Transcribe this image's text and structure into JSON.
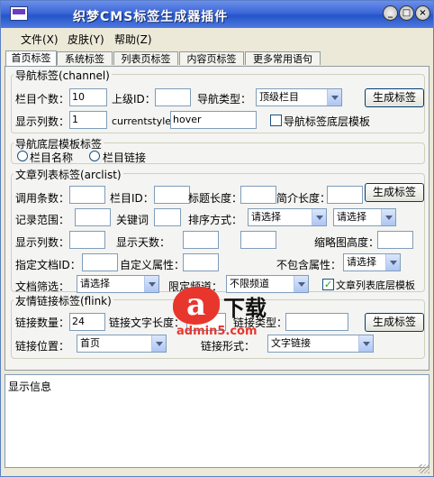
{
  "window": {
    "title": "织梦CMS标签生成器插件"
  },
  "menu": [
    "文件(X)",
    "皮肤(Y)",
    "帮助(Z)"
  ],
  "tabs": [
    "首页标签",
    "系统标签",
    "列表页标签",
    "内容页标签",
    "更多常用语句"
  ],
  "nav": {
    "legend": "导航标签(channel)",
    "count_label": "栏目个数：",
    "count_value": "10",
    "upid_label": "上级ID：",
    "upid_value": "",
    "type_label": "导航类型：",
    "type_value": "顶级栏目",
    "cols_label": "显示列数：",
    "cols_value": "1",
    "style_label": "currentstyle：",
    "style_value": "hover",
    "bottom_check": "导航标签底层模板",
    "button": "生成标签"
  },
  "navtpl": {
    "legend": "导航底层模板标签",
    "radio1": "栏目名称",
    "radio2": "栏目链接"
  },
  "arclist": {
    "legend": "文章列表标签(arclist)",
    "r1": [
      "调用条数：",
      "栏目ID：",
      "标题长度：",
      "简介长度："
    ],
    "r2": [
      "记录范围：",
      "关键词",
      "排序方式：",
      "请选择",
      "请选择"
    ],
    "r3": [
      "显示列数：",
      "显示天数：",
      "缩略图高度："
    ],
    "r4": [
      "指定文档ID：",
      "自定义属性：",
      "不包含属性：",
      "请选择"
    ],
    "r5": [
      "文档筛选：",
      "请选择",
      "限定频道：",
      "不限频道"
    ],
    "bottom_check": "文章列表底层模板",
    "button": "生成标签"
  },
  "flink": {
    "legend": "友情链接标签(flink)",
    "count_label": "链接数量：",
    "count_value": "24",
    "len_label": "链接文字长度：",
    "type_label": "链接类型：",
    "pos_label": "链接位置：",
    "pos_value": "首页",
    "form_label": "链接形式：",
    "form_value": "文字链接",
    "button": "生成标签"
  },
  "status": {
    "text": "显示信息"
  },
  "watermark": {
    "logo": "a",
    "num": "5",
    "text": "下载",
    "url": "admin5.com"
  },
  "colors": {
    "titlebar": "#2455c8",
    "panel": "#f4f4f2",
    "accent": "#e8362d"
  }
}
